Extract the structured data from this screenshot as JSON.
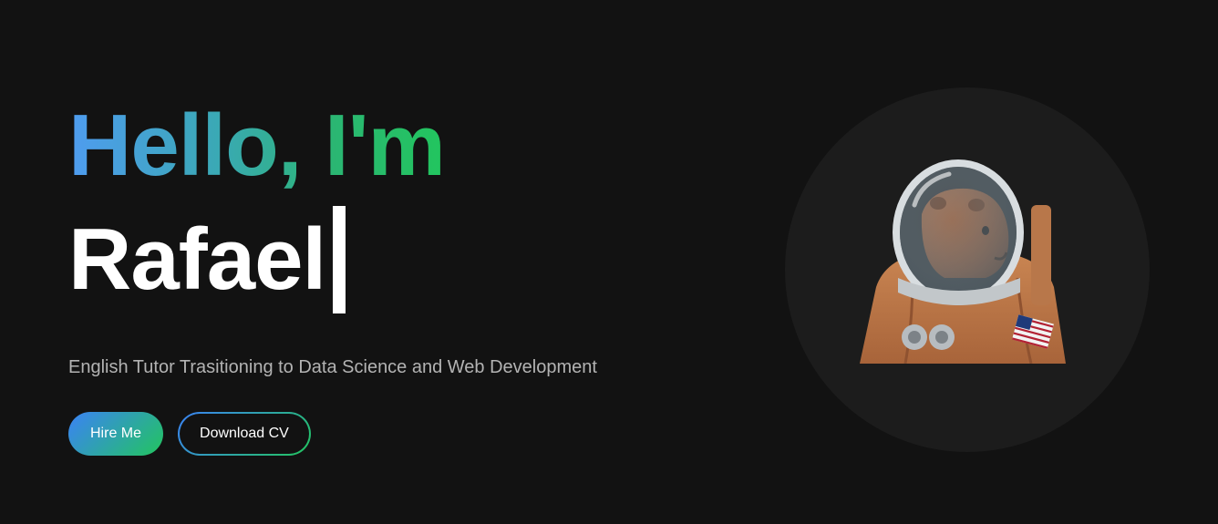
{
  "hero": {
    "greeting": "Hello, I'm",
    "name": "Rafael",
    "subtitle": "English Tutor Trasitioning to Data Science and Web Development",
    "buttons": {
      "hire_label": "Hire Me",
      "download_label": "Download CV"
    },
    "avatar_icon": "capybara-astronaut-illustration"
  },
  "colors": {
    "background": "#121212",
    "accent_start": "#3b82f6",
    "accent_end": "#22c55e",
    "subtitle": "#b3b3b3",
    "portrait_bg": "#1c1c1c"
  }
}
